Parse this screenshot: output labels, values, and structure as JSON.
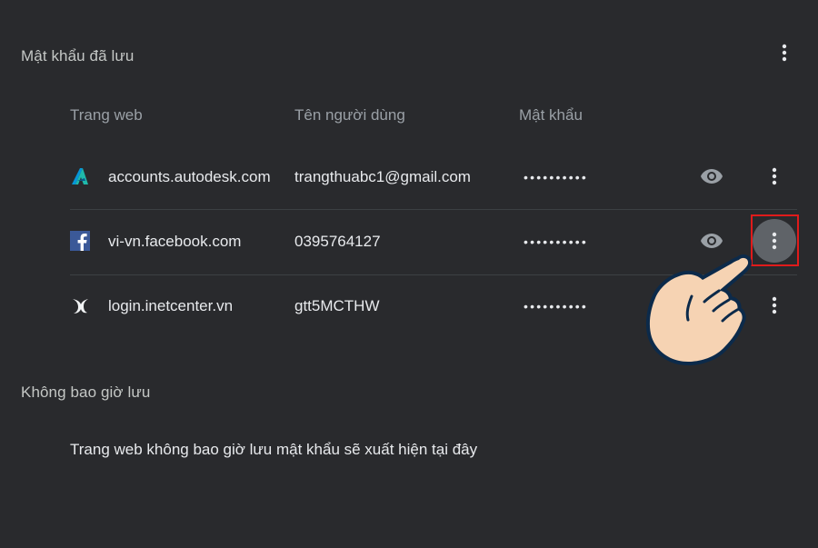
{
  "saved_passwords": {
    "title": "Mật khẩu đã lưu",
    "columns": {
      "website": "Trang web",
      "username": "Tên người dùng",
      "password": "Mật khẩu"
    },
    "entries": [
      {
        "site": "accounts.autodesk.com",
        "username": "trangthuabc1@gmail.com",
        "password": "••••••••••",
        "icon": "autodesk-logo-icon"
      },
      {
        "site": "vi-vn.facebook.com",
        "username": "0395764127",
        "password": "••••••••••",
        "icon": "facebook-logo-icon"
      },
      {
        "site": "login.inetcenter.vn",
        "username": "gtt5MCTHW",
        "password": "••••••••••",
        "icon": "inet-logo-icon"
      }
    ]
  },
  "never_saved": {
    "title": "Không bao giờ lưu",
    "empty_message": "Trang web không bao giờ lưu mật khẩu sẽ xuất hiện tại đây"
  },
  "colors": {
    "background": "#292a2d",
    "text": "#e8eaed",
    "muted": "#9aa0a6",
    "highlight": "#e01b1b",
    "hover_circle": "#5f6368"
  }
}
